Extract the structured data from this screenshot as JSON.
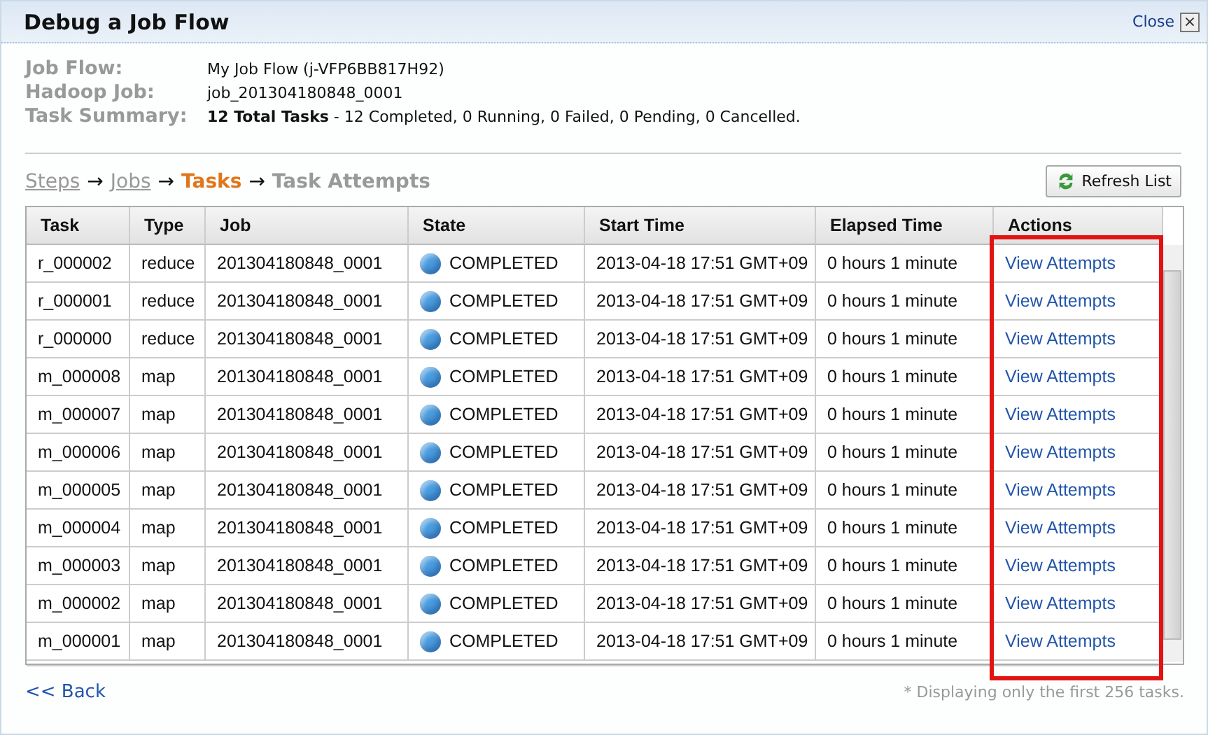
{
  "window": {
    "title": "Debug a Job Flow",
    "close_label": "Close",
    "close_glyph": "×"
  },
  "info": [
    {
      "label": "Job Flow:",
      "value": "My Job Flow (j-VFP6BB817H92)"
    },
    {
      "label": "Hadoop Job:",
      "value": "job_201304180848_0001"
    },
    {
      "label": "Task Summary:",
      "value": "**12 Total Tasks** - 12 Completed, 0 Running, 0 Failed, 0 Pending, 0 Cancelled."
    }
  ],
  "breadcrumb": [
    {
      "label": "Steps",
      "kind": "link"
    },
    {
      "label": "→",
      "kind": "arrow"
    },
    {
      "label": "Jobs",
      "kind": "link"
    },
    {
      "label": "→",
      "kind": "arrow"
    },
    {
      "label": "Tasks",
      "kind": "current"
    },
    {
      "label": "→",
      "kind": "arrow"
    },
    {
      "label": "Task Attempts",
      "kind": "plain"
    }
  ],
  "refresh_button": "Refresh List",
  "table": {
    "columns": [
      "Task",
      "Type",
      "Job",
      "State",
      "Start Time",
      "Elapsed Time",
      "Actions"
    ],
    "rows": [
      {
        "task": "r_000002",
        "type": "reduce",
        "job": "201304180848_0001",
        "state": "COMPLETED",
        "color": "#4a9de0",
        "start": "2013-04-18 17:51 GMT+09",
        "elapsed": "0 hours 1 minute",
        "action": "View Attempts"
      },
      {
        "task": "r_000001",
        "type": "reduce",
        "job": "201304180848_0001",
        "state": "COMPLETED",
        "color": "#4a9de0",
        "start": "2013-04-18 17:51 GMT+09",
        "elapsed": "0 hours 1 minute",
        "action": "View Attempts"
      },
      {
        "task": "r_000000",
        "type": "reduce",
        "job": "201304180848_0001",
        "state": "COMPLETED",
        "color": "#4a9de0",
        "start": "2013-04-18 17:51 GMT+09",
        "elapsed": "0 hours 1 minute",
        "action": "View Attempts"
      },
      {
        "task": "m_000008",
        "type": "map",
        "job": "201304180848_0001",
        "state": "COMPLETED",
        "color": "#4a9de0",
        "start": "2013-04-18 17:51 GMT+09",
        "elapsed": "0 hours 1 minute",
        "action": "View Attempts"
      },
      {
        "task": "m_000007",
        "type": "map",
        "job": "201304180848_0001",
        "state": "COMPLETED",
        "color": "#4a9de0",
        "start": "2013-04-18 17:51 GMT+09",
        "elapsed": "0 hours 1 minute",
        "action": "View Attempts"
      },
      {
        "task": "m_000006",
        "type": "map",
        "job": "201304180848_0001",
        "state": "COMPLETED",
        "color": "#4a9de0",
        "start": "2013-04-18 17:51 GMT+09",
        "elapsed": "0 hours 1 minute",
        "action": "View Attempts"
      },
      {
        "task": "m_000005",
        "type": "map",
        "job": "201304180848_0001",
        "state": "COMPLETED",
        "color": "#4a9de0",
        "start": "2013-04-18 17:51 GMT+09",
        "elapsed": "0 hours 1 minute",
        "action": "View Attempts"
      },
      {
        "task": "m_000004",
        "type": "map",
        "job": "201304180848_0001",
        "state": "COMPLETED",
        "color": "#4a9de0",
        "start": "2013-04-18 17:51 GMT+09",
        "elapsed": "0 hours 1 minute",
        "action": "View Attempts"
      },
      {
        "task": "m_000003",
        "type": "map",
        "job": "201304180848_0001",
        "state": "COMPLETED",
        "color": "#4a9de0",
        "start": "2013-04-18 17:51 GMT+09",
        "elapsed": "0 hours 1 minute",
        "action": "View Attempts"
      },
      {
        "task": "m_000002",
        "type": "map",
        "job": "201304180848_0001",
        "state": "COMPLETED",
        "color": "#4a9de0",
        "start": "2013-04-18 17:51 GMT+09",
        "elapsed": "0 hours 1 minute",
        "action": "View Attempts"
      },
      {
        "task": "m_000001",
        "type": "map",
        "job": "201304180848_0001",
        "state": "COMPLETED",
        "color": "#4a9de0",
        "start": "2013-04-18 17:51 GMT+09",
        "elapsed": "0 hours 1 minute",
        "action": "View Attempts"
      }
    ]
  },
  "back_link": "<< Back",
  "footnote": "* Displaying only the first 256 tasks."
}
